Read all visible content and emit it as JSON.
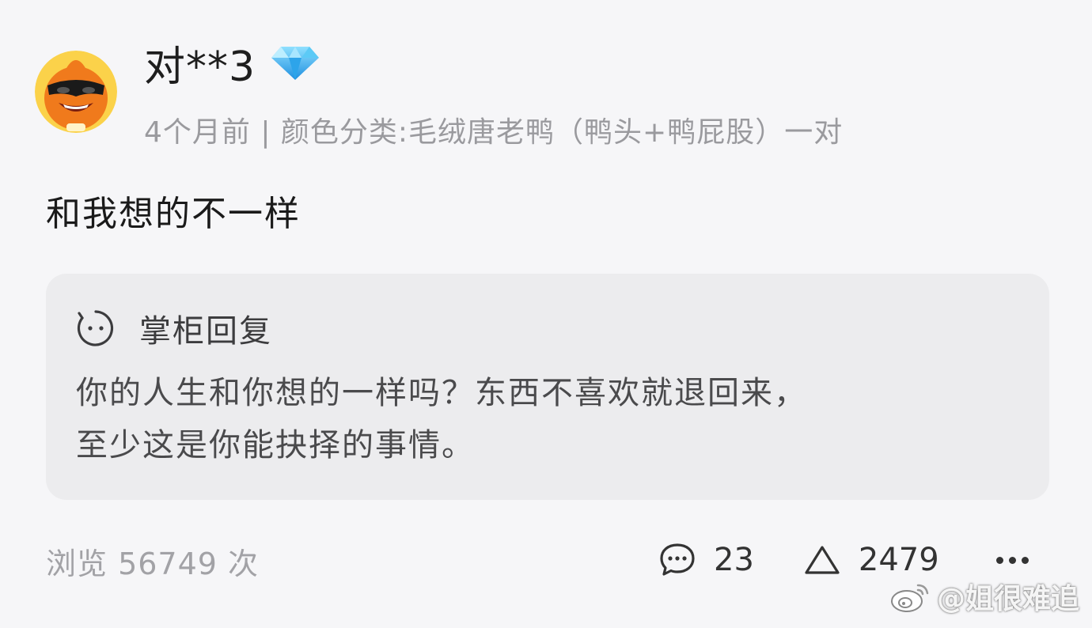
{
  "user": {
    "name": "对**3",
    "avatar_icon": "cartoon-duck-sunglasses-avatar",
    "badge_icon": "diamond-icon"
  },
  "review": {
    "meta": "4个月前 | 颜色分类:毛绒唐老鸭（鸭头+鸭屁股）一对",
    "text": "和我想的不一样"
  },
  "reply": {
    "title": "掌柜回复",
    "icon": "shop-face-icon",
    "lines": [
      "你的人生和你想的一样吗？东西不喜欢就退回来，",
      "至少这是你能抉择的事情。"
    ]
  },
  "footer": {
    "views": "浏览 56749 次",
    "comment_icon": "comment-bubble-icon",
    "comments": "23",
    "like_icon": "triangle-up-icon",
    "likes": "2479",
    "more_icon": "more-dots-icon"
  },
  "watermark": {
    "icon": "weibo-logo",
    "text": "@姐很难追"
  },
  "colors": {
    "background": "#f6f6f8",
    "card": "#ececee",
    "meta_gray": "#9a9a9e",
    "diamond_blue": "#3fb4f0",
    "avatar_orange": "#f07a1c"
  }
}
